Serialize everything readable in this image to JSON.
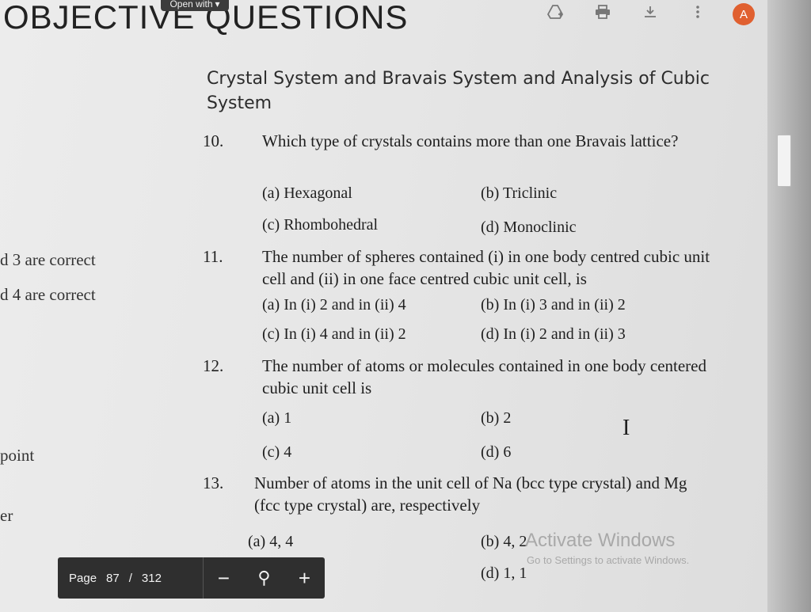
{
  "header": {
    "heading": "OBJECTIVE QUESTIONS",
    "open_with": "Open with",
    "avatar_letter": "A",
    "icons": [
      "add-to-drive-icon",
      "print-icon",
      "download-icon",
      "more-vert-icon"
    ]
  },
  "section_title": "Crystal System and Bravais System and Analysis of Cubic System",
  "side_fragments": [
    "d 3 are correct",
    "d 4 are correct",
    "point",
    "er"
  ],
  "questions": [
    {
      "num": "10.",
      "text": "Which type of crystals contains more than one Bravais lattice?",
      "options": [
        "(a) Hexagonal",
        "(b) Triclinic",
        "(c) Rhombohedral",
        "(d) Monoclinic"
      ]
    },
    {
      "num": "11.",
      "text": "The number of spheres contained (i) in one body centred cubic unit cell and (ii) in one face centred cubic unit cell, is",
      "options": [
        "(a) In (i) 2 and in (ii) 4",
        "(b) In (i) 3 and in (ii) 2",
        "(c) In (i) 4 and in (ii) 2",
        "(d) In (i) 2 and in (ii) 3"
      ]
    },
    {
      "num": "12.",
      "text": "The number of atoms or molecules contained in one body centered cubic unit cell is",
      "options": [
        "(a) 1",
        "(b) 2",
        "(c) 4",
        "(d) 6"
      ]
    },
    {
      "num": "13.",
      "text": "Number of atoms in the unit cell of Na (bcc type crystal) and Mg (fcc type crystal) are, respectively",
      "options": [
        "(a) 4, 4",
        "(b) 4, 2",
        "(d) 1, 1"
      ]
    }
  ],
  "cursor_glyph": "I",
  "watermark": {
    "line1": "Activate Windows",
    "line2": "Go to Settings to activate Windows."
  },
  "pagebar": {
    "page_label": "Page",
    "current": "87",
    "slash": "/",
    "total": "312",
    "zoom_out": "−",
    "zoom_icon": "⚲",
    "zoom_in": "+"
  }
}
